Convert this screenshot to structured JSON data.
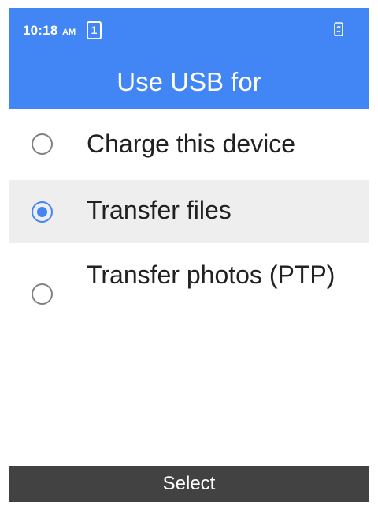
{
  "status_bar": {
    "time": "10:18",
    "ampm": "AM",
    "sim_slot": "1",
    "rotate_icon": "screen-rotation-icon"
  },
  "header": {
    "title": "Use USB for",
    "background_color": "#4285f4"
  },
  "options": [
    {
      "label": "Charge this device",
      "selected": false
    },
    {
      "label": "Transfer files",
      "selected": true
    },
    {
      "label": "Transfer photos (PTP)",
      "selected": false
    }
  ],
  "footer": {
    "select_label": "Select"
  },
  "colors": {
    "accent": "#4285f4",
    "selected_row": "#eeeeee",
    "footer_bg": "#424242"
  }
}
